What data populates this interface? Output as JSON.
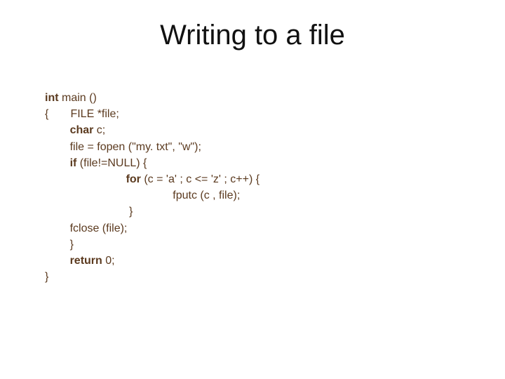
{
  "title": "Writing to a file",
  "code": {
    "l1a": "int",
    "l1b": " main ()",
    "l2": "{       FILE *file;",
    "l3a": "        ",
    "l3b": "char",
    "l3c": " c;",
    "l4": "        file = fopen (\"my. txt\", \"w\");",
    "l5a": "        ",
    "l5b": "if",
    "l5c": " (file!=NULL) {",
    "l6a": "                          ",
    "l6b": "for",
    "l6c": " (c = 'a' ; c <= 'z' ; c++) {",
    "l7": "                                         fputc (c , file);",
    "l8": "                           }",
    "l9": "        fclose (file);",
    "l10": "        }",
    "l11a": "        ",
    "l11b": "return",
    "l11c": " 0;",
    "l12": "}"
  }
}
